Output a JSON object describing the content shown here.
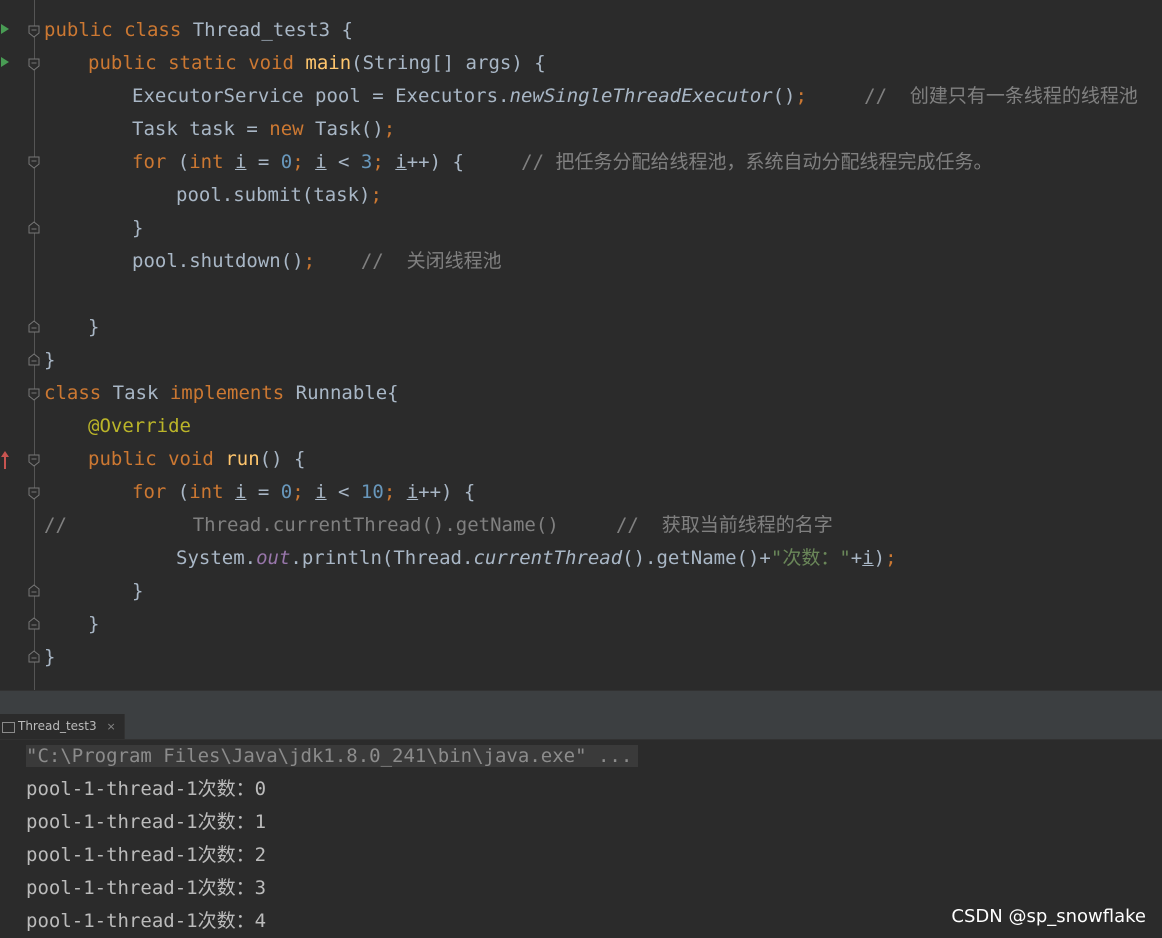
{
  "code_lines": [
    "public class Thread_test3 {",
    "public static void main(String[] args) {",
    "ExecutorService pool = Executors.newSingleThreadExecutor();     //  创建只有一条线程的线程池",
    "Task task = new Task();",
    "for (int i = 0; i < 3; i++) {     // 把任务分配给线程池，系统自动分配线程完成任务。",
    "pool.submit(task);",
    "}",
    "pool.shutdown();    //  关闭线程池",
    "",
    "}",
    "}",
    "class Task implements Runnable{",
    "@Override",
    "public void run() {",
    "for (int i = 0; i < 10; i++) {",
    "//           Thread.currentThread().getName()     //  获取当前线程的名字",
    "System.out.println(Thread.currentThread().getName()+\"次数：\"+i);",
    "}",
    "}",
    "}"
  ],
  "console": {
    "tab_label": "Thread_test3",
    "tab_close": "×",
    "command": "\"C:\\Program Files\\Java\\jdk1.8.0_241\\bin\\java.exe\" ...",
    "output": [
      "pool-1-thread-1次数：0",
      "pool-1-thread-1次数：1",
      "pool-1-thread-1次数：2",
      "pool-1-thread-1次数：3",
      "pool-1-thread-1次数：4"
    ]
  },
  "watermark": "CSDN @sp_snowflake",
  "colors": {
    "background": "#2b2b2b",
    "keyword": "#cc7832",
    "method": "#ffc66d",
    "number": "#6897bb",
    "comment": "#808080",
    "string": "#6a8759",
    "annotation": "#bbb529",
    "field": "#9876aa",
    "text": "#a9b7c6"
  },
  "icons": [
    "run-arrow-icon",
    "override-marker-icon",
    "fold-icon",
    "console-icon",
    "close-icon"
  ]
}
